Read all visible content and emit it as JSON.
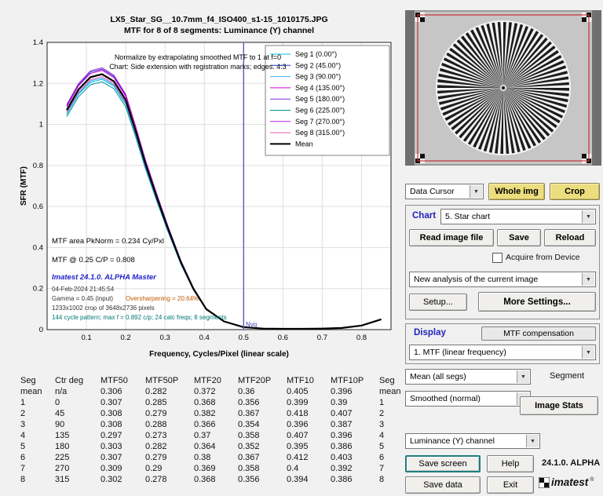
{
  "figure": {
    "title_line1": "LX5_Star_SG__10.7mm_f4_ISO400_s1-15_1010175.JPG",
    "title_line2": "MTF for 8 of 8 segments:  Luminance (Y) channel",
    "note1": "Normalize by extrapolating smoothed MTF to 1 at f=0",
    "note2": "Chart: Side extension with registration marks; edges. 4:3",
    "stat_mtf_area": "MTF area PkNorm = 0.234 Cy/Pxl",
    "stat_mtf_025": "MTF @ 0.25 C/P = 0.808",
    "brand": "Imatest 24.1.0. ALPHA Master",
    "datetime": "04-Feb-2024 21:45:54",
    "gamma": "Gamma = 0.45 (input)",
    "oversharpening": "Oversharpening = 20.64%",
    "crop_info": "1233x1002 crop of 3648x2736 pixels",
    "pattern_info": "144 cycle pattern; max f = 0.892 c/p;  24 calc freqs;  8 segments",
    "nyquist_label": "Nyq"
  },
  "chart_data": {
    "type": "line",
    "title": "MTF for 8 of 8 segments: Luminance (Y) channel",
    "xlabel": "Frequency, Cycles/Pixel (linear scale)",
    "ylabel": "SFR (MTF)",
    "xlim": [
      0,
      0.875
    ],
    "ylim": [
      0,
      1.4
    ],
    "xticks": [
      0.1,
      0.2,
      0.3,
      0.4,
      0.5,
      0.6,
      0.7,
      0.8
    ],
    "yticks": [
      0,
      0.2,
      0.4,
      0.6,
      0.8,
      1,
      1.2,
      1.4
    ],
    "nyquist_x": 0.5,
    "grid": true,
    "legend_position": "upper right",
    "x": [
      0.05,
      0.08,
      0.11,
      0.14,
      0.17,
      0.2,
      0.225,
      0.25,
      0.28,
      0.306,
      0.34,
      0.372,
      0.405,
      0.45,
      0.5,
      0.55,
      0.6,
      0.65,
      0.7,
      0.75,
      0.8,
      0.85
    ],
    "series": [
      {
        "name": "Seg 1 (0.00°)",
        "color": "#00c0e0",
        "values": [
          1.049,
          1.147,
          1.205,
          1.22,
          1.186,
          1.098,
          0.951,
          0.794,
          0.627,
          0.49,
          0.323,
          0.196,
          0.098,
          0.039,
          0.012,
          0.005,
          0.004,
          0.004,
          0.005,
          0.008,
          0.02,
          0.049
        ]
      },
      {
        "name": "Seg 2 (45.00°)",
        "color": "#2038d8",
        "values": [
          1.091,
          1.193,
          1.255,
          1.27,
          1.234,
          1.142,
          0.989,
          0.826,
          0.653,
          0.51,
          0.337,
          0.204,
          0.102,
          0.041,
          0.012,
          0.005,
          0.004,
          0.004,
          0.005,
          0.008,
          0.02,
          0.051
        ]
      },
      {
        "name": "Seg 3 (90.00°)",
        "color": "#40b0f0",
        "values": [
          1.054,
          1.152,
          1.212,
          1.226,
          1.192,
          1.103,
          0.955,
          0.798,
          0.63,
          0.493,
          0.325,
          0.197,
          0.099,
          0.039,
          0.012,
          0.005,
          0.004,
          0.004,
          0.005,
          0.008,
          0.02,
          0.049
        ]
      },
      {
        "name": "Seg 4 (135.00°)",
        "color": "#cc00cc",
        "values": [
          1.086,
          1.188,
          1.248,
          1.264,
          1.228,
          1.137,
          0.985,
          0.822,
          0.65,
          0.508,
          0.335,
          0.203,
          0.102,
          0.041,
          0.012,
          0.005,
          0.004,
          0.004,
          0.005,
          0.008,
          0.02,
          0.051
        ]
      },
      {
        "name": "Seg 5 (180.00°)",
        "color": "#7a2fd6",
        "values": [
          1.07,
          1.17,
          1.23,
          1.245,
          1.21,
          1.12,
          0.97,
          0.81,
          0.64,
          0.5,
          0.33,
          0.2,
          0.1,
          0.04,
          0.012,
          0.005,
          0.004,
          0.004,
          0.005,
          0.008,
          0.02,
          0.05
        ]
      },
      {
        "name": "Seg 6 (225.00°)",
        "color": "#008fa0",
        "values": [
          1.038,
          1.135,
          1.193,
          1.208,
          1.174,
          1.086,
          0.941,
          0.786,
          0.621,
          0.485,
          0.32,
          0.194,
          0.097,
          0.039,
          0.012,
          0.005,
          0.004,
          0.004,
          0.005,
          0.008,
          0.019,
          0.049
        ]
      },
      {
        "name": "Seg 7 (270.00°)",
        "color": "#b020d0",
        "values": [
          1.097,
          1.199,
          1.261,
          1.276,
          1.24,
          1.148,
          0.994,
          0.83,
          0.656,
          0.513,
          0.338,
          0.205,
          0.103,
          0.041,
          0.012,
          0.005,
          0.004,
          0.004,
          0.005,
          0.008,
          0.021,
          0.051
        ]
      },
      {
        "name": "Seg 8 (315.00°)",
        "color": "#e858b8",
        "values": [
          1.059,
          1.158,
          1.218,
          1.233,
          1.198,
          1.109,
          0.96,
          0.802,
          0.634,
          0.495,
          0.327,
          0.198,
          0.099,
          0.04,
          0.012,
          0.005,
          0.004,
          0.004,
          0.005,
          0.008,
          0.02,
          0.05
        ]
      },
      {
        "name": "Mean",
        "color": "#000000",
        "values": [
          1.07,
          1.17,
          1.23,
          1.245,
          1.21,
          1.12,
          0.97,
          0.81,
          0.64,
          0.5,
          0.33,
          0.2,
          0.1,
          0.04,
          0.012,
          0.005,
          0.004,
          0.004,
          0.005,
          0.008,
          0.02,
          0.05
        ]
      }
    ]
  },
  "table": {
    "headers": [
      "Seg",
      "Ctr deg",
      "MTF50",
      "MTF50P",
      "MTF20",
      "MTF20P",
      "MTF10",
      "MTF10P",
      "Seg"
    ],
    "rows": [
      [
        "mean",
        "n/a",
        "0.306",
        "0.282",
        "0.372",
        "0.36",
        "0.405",
        "0.396",
        "mean"
      ],
      [
        "1",
        "0",
        "0.307",
        "0.285",
        "0.368",
        "0.356",
        "0.399",
        "0.39",
        "1"
      ],
      [
        "2",
        "45",
        "0.308",
        "0.279",
        "0.382",
        "0.367",
        "0.418",
        "0.407",
        "2"
      ],
      [
        "3",
        "90",
        "0.308",
        "0.288",
        "0.366",
        "0.354",
        "0.396",
        "0.387",
        "3"
      ],
      [
        "4",
        "135",
        "0.297",
        "0.273",
        "0.37",
        "0.358",
        "0.407",
        "0.396",
        "4"
      ],
      [
        "5",
        "180",
        "0.303",
        "0.282",
        "0.364",
        "0.352",
        "0.395",
        "0.386",
        "5"
      ],
      [
        "6",
        "225",
        "0.307",
        "0.279",
        "0.38",
        "0.367",
        "0.412",
        "0.403",
        "6"
      ],
      [
        "7",
        "270",
        "0.309",
        "0.29",
        "0.369",
        "0.358",
        "0.4",
        "0.392",
        "7"
      ],
      [
        "8",
        "315",
        "0.302",
        "0.278",
        "0.368",
        "0.356",
        "0.394",
        "0.386",
        "8"
      ]
    ]
  },
  "controls": {
    "data_cursor": "Data Cursor",
    "whole_img": "Whole img",
    "crop": "Crop",
    "chart_label": "Chart",
    "chart_type": "5. Star chart",
    "read_image_file": "Read image file",
    "save": "Save",
    "reload": "Reload",
    "acquire_from_device": "Acquire from Device",
    "analysis_mode": "New analysis of the current image",
    "setup": "Setup...",
    "more_settings": "More Settings...",
    "display_label": "Display",
    "mtf_compensation": "MTF compensation",
    "display_mode": "1. MTF (linear frequency)",
    "segment_mode": "Mean (all segs)",
    "segment_label": "Segment",
    "smoothing": "Smoothed (normal)",
    "image_stats": "Image Stats",
    "channel": "Luminance (Y) channel",
    "save_screen": "Save screen",
    "help": "Help",
    "version": "24.1.0. ALPHA",
    "save_data": "Save data",
    "exit": "Exit",
    "logo_text": "imatest",
    "logo_reg": "®"
  },
  "colors": {
    "accent_blue": "#2222bb",
    "yellow_button": "#ecdd7e",
    "nyquist_line": "#5050c8",
    "crop_overlay_red": "#c23030"
  }
}
